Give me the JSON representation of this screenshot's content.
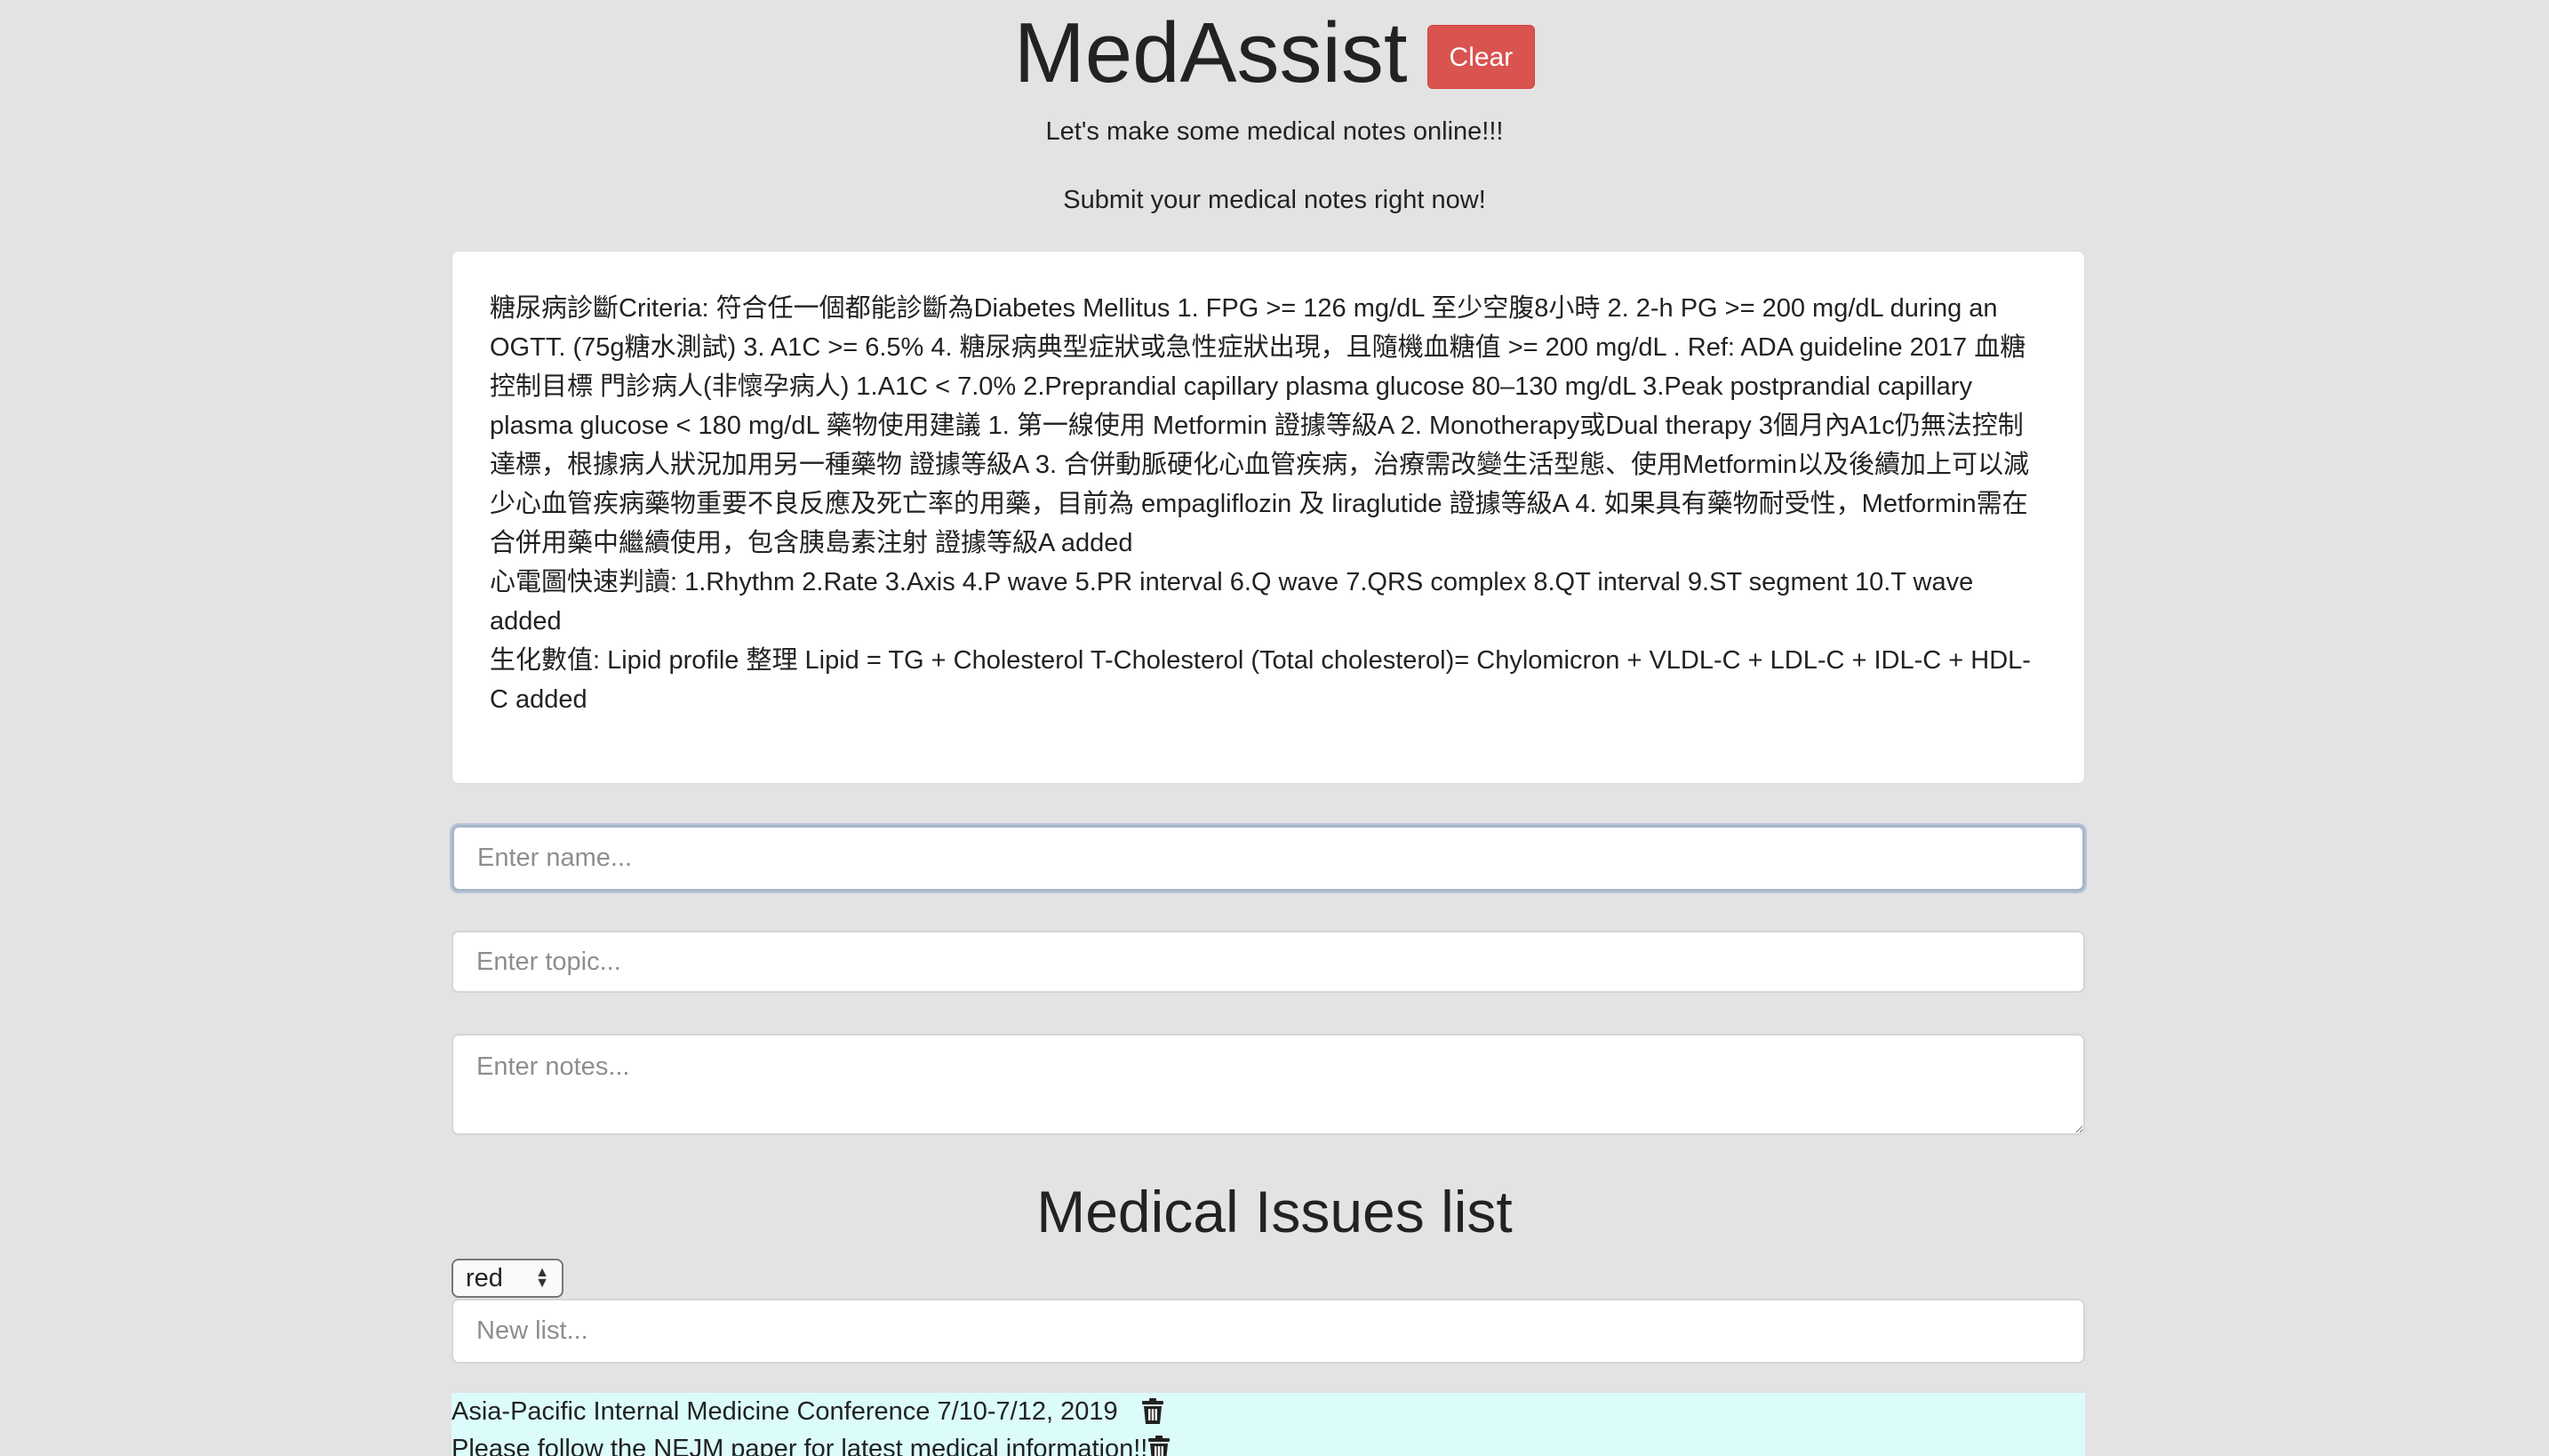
{
  "header": {
    "title": "MedAssist",
    "clear_label": "Clear",
    "subtitle_1": "Let's make some medical notes online!!!",
    "subtitle_2": "Submit your medical notes right now!"
  },
  "notes_display": {
    "entries": [
      "糖尿病診斷Criteria: 符合任一個都能診斷為Diabetes Mellitus 1. FPG >= 126 mg/dL 至少空腹8小時 2. 2-h PG >= 200 mg/dL during an OGTT. (75g糖水測試) 3. A1C >= 6.5% 4. 糖尿病典型症狀或急性症狀出現，且隨機血糖值 >= 200 mg/dL . Ref: ADA guideline 2017 血糖控制目標 門診病人(非懷孕病人) 1.A1C < 7.0% 2.Preprandial capillary plasma glucose 80–130 mg/dL 3.Peak postprandial capillary plasma glucose < 180 mg/dL 藥物使用建議 1. 第一線使用 Metformin 證據等級A 2. Monotherapy或Dual therapy 3個月內A1c仍無法控制達標，根據病人狀況加用另一種藥物 證據等級A 3. 合併動脈硬化心血管疾病，治療需改變生活型態、使用Metformin以及後續加上可以減少心血管疾病藥物重要不良反應及死亡率的用藥，目前為 empagliflozin 及 liraglutide 證據等級A 4. 如果具有藥物耐受性，Metformin需在合併用藥中繼續使用，包含胰島素注射 證據等級A added",
      "心電圖快速判讀: 1.Rhythm 2.Rate 3.Axis 4.P wave 5.PR interval 6.Q wave 7.QRS complex 8.QT interval 9.ST segment 10.T wave added",
      "生化數值: Lipid profile 整理 Lipid = TG + Cholesterol T-Cholesterol (Total cholesterol)= Chylomicron + VLDL-C + LDL-C + IDL-C + HDL-C added"
    ]
  },
  "form": {
    "name_placeholder": "Enter name...",
    "topic_placeholder": "Enter topic...",
    "notes_placeholder": "Enter notes..."
  },
  "issues": {
    "heading": "Medical Issues list",
    "color_select_value": "red",
    "new_list_placeholder": "New list...",
    "list_background": "#dcfcfc",
    "items": [
      {
        "text": "Asia-Pacific Internal Medicine Conference 7/10-7/12, 2019",
        "icon": "trash-icon"
      },
      {
        "text": "Please follow the NEJM paper for latest medical information!!",
        "icon": "trash-icon"
      }
    ]
  },
  "colors": {
    "background": "#e3e3e3",
    "clear_button": "#d9534f"
  }
}
